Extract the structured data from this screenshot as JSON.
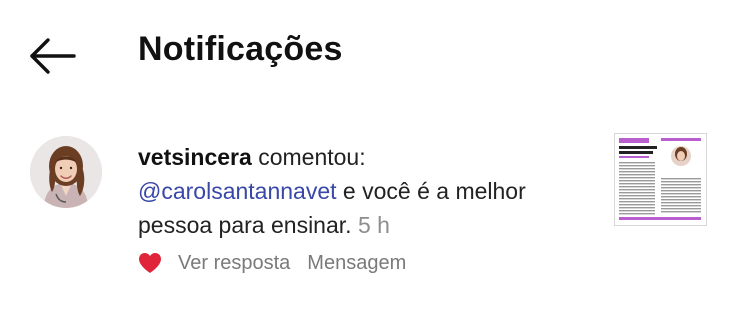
{
  "header": {
    "title": "Notificações",
    "back_icon": "arrow-left-icon"
  },
  "notification": {
    "username": "vetsincera",
    "action_text": " comentou:",
    "mention": "@carolsantannavet",
    "comment_text": " e você é a melhor pessoa para ensinar.",
    "time": "5 h",
    "actions": {
      "like_icon": "heart-filled-icon",
      "like_color": "#e0243a",
      "reply_label": "Ver resposta",
      "message_label": "Mensagem"
    },
    "thumbnail": {
      "headline": "Telemedicina veterinária",
      "accent_color": "#b85ecf"
    }
  },
  "colors": {
    "mention": "#3847a8",
    "muted": "#8e8e8e",
    "text": "#111111"
  }
}
